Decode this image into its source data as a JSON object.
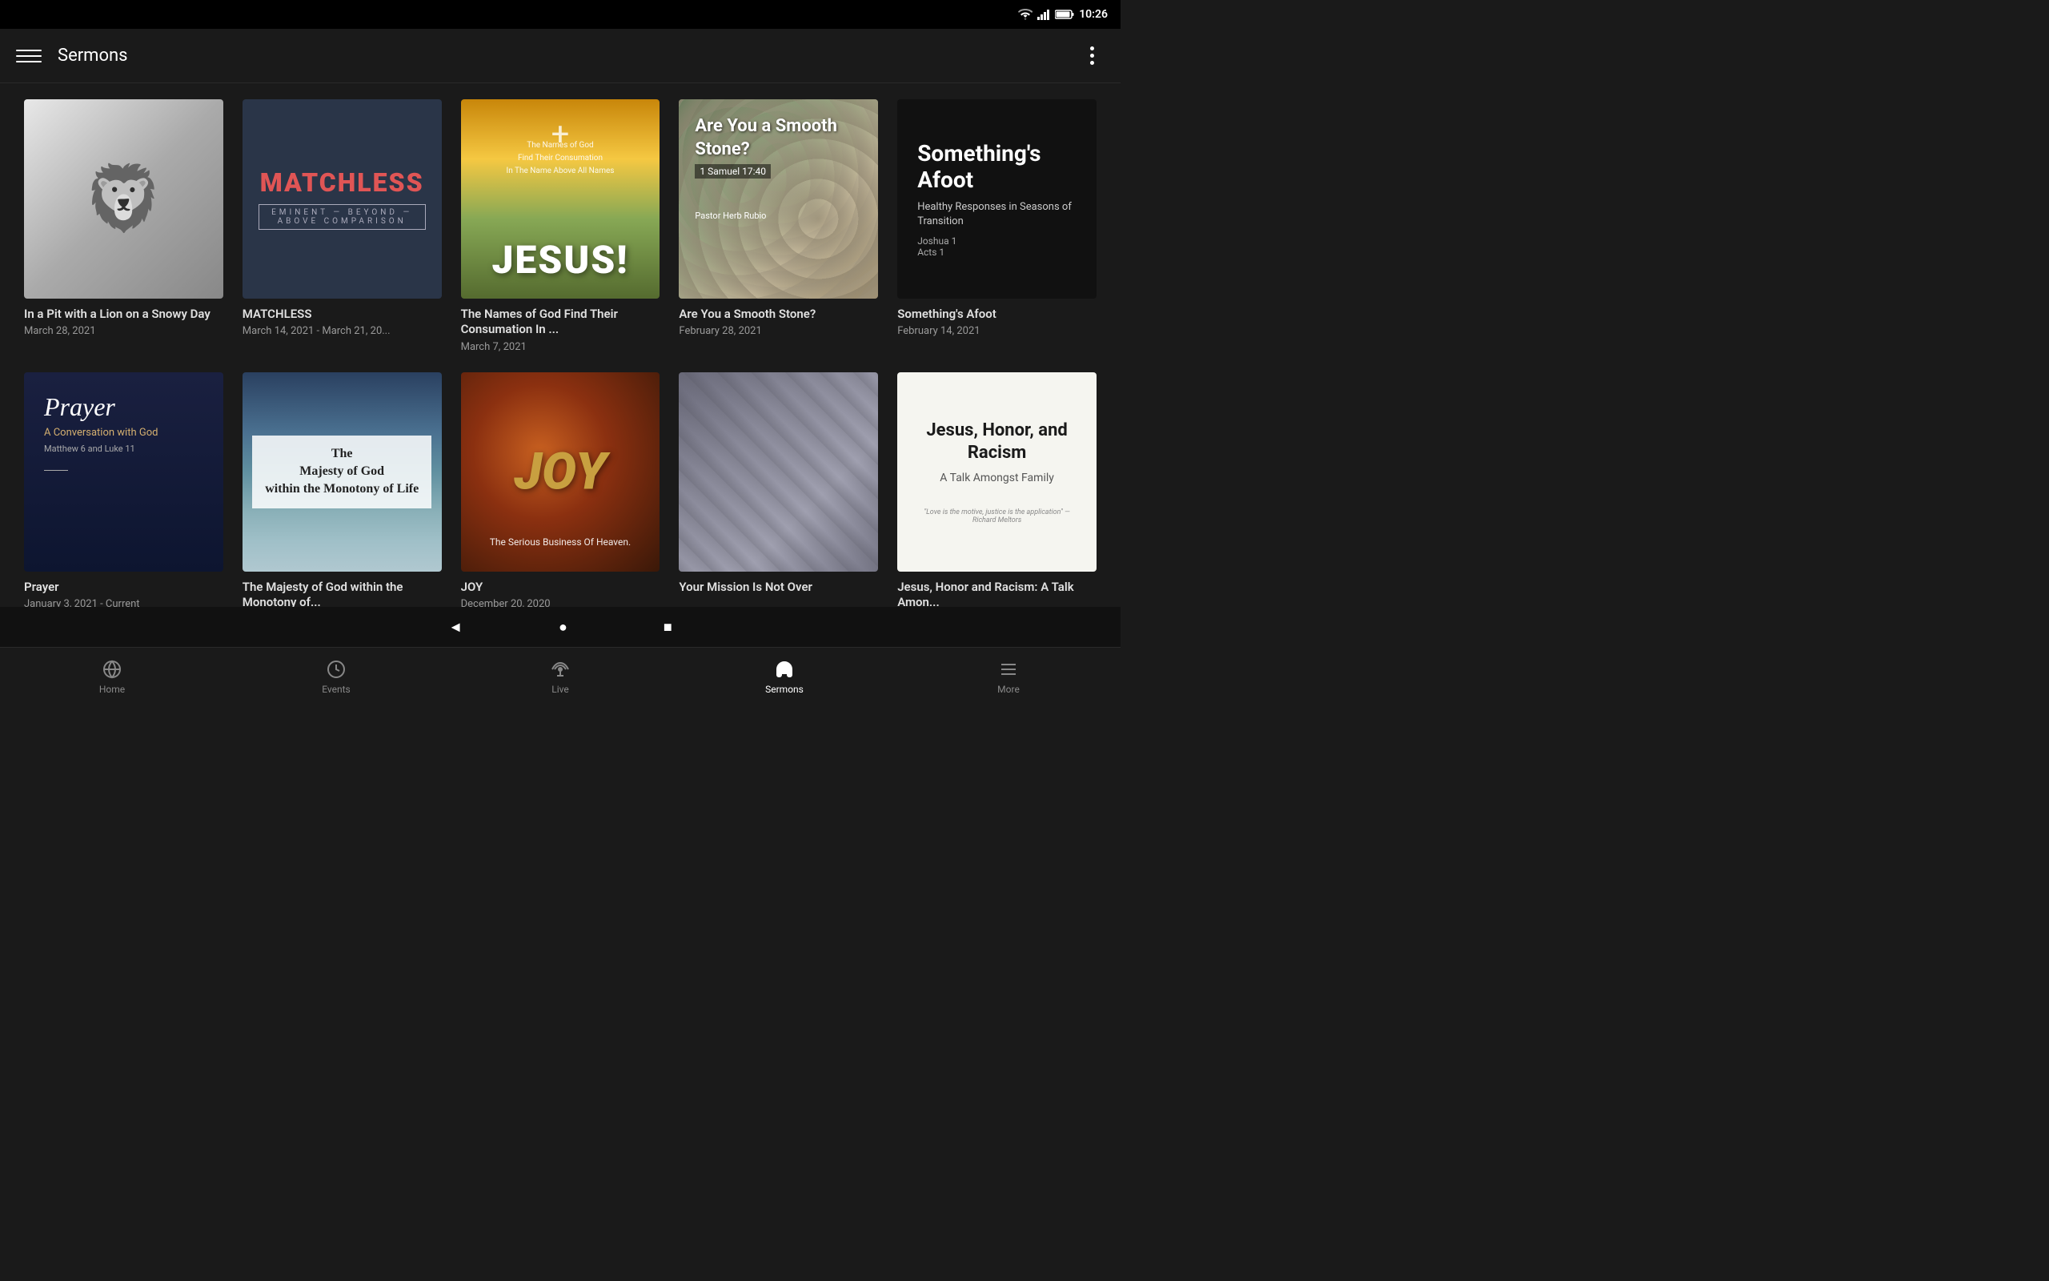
{
  "statusBar": {
    "time": "10:26",
    "icons": [
      "wifi",
      "signal",
      "battery"
    ]
  },
  "appBar": {
    "title": "Sermons",
    "menuIcon": "menu",
    "moreIcon": "more-vertical"
  },
  "sermons": [
    {
      "id": 1,
      "title": "In a Pit with a Lion on a Snowy Day",
      "date": "March 28, 2021",
      "thumbType": "lion"
    },
    {
      "id": 2,
      "title": "MATCHLESS",
      "date": "March 14, 2021 - March 21, 20...",
      "thumbType": "matchless",
      "thumbText": "MATCHLESS",
      "thumbSub": "EMINENT — BEYOND — ABOVE COMPARISON"
    },
    {
      "id": 3,
      "title": "The Names of God Find Their Consumation In ...",
      "date": "March 7, 2021",
      "thumbType": "jesus",
      "thumbTopText": "The Names of God\nFind Their Consumation\nIn The Name Above All Names",
      "thumbMain": "JESUS!"
    },
    {
      "id": 4,
      "title": "Are You a Smooth Stone?",
      "date": "February 28, 2021",
      "thumbType": "stones",
      "thumbTitle": "Are You a Smooth Stone?",
      "thumbVerse": "1 Samuel 17:40",
      "thumbPastor": "Pastor Herb Rubio"
    },
    {
      "id": 5,
      "title": "Something's Afoot",
      "date": "February 14, 2021",
      "thumbType": "afoot",
      "thumbTitle": "Something's Afoot",
      "thumbSub": "Healthy Responses in Seasons of Transition",
      "thumbBooks": "Joshua 1\nActs 1"
    },
    {
      "id": 6,
      "title": "Prayer",
      "date": "January 3, 2021 - Current",
      "thumbType": "prayer",
      "thumbScript": "Prayer",
      "thumbSub": "A Conversation with God",
      "thumbVerse": "Matthew 6 and Luke 11"
    },
    {
      "id": 7,
      "title": "The Majesty of God within the Monotony of...",
      "date": "",
      "thumbType": "majesty",
      "thumbText": "The Majesty of God within the Monotony of Life"
    },
    {
      "id": 8,
      "title": "JOY",
      "date": "December 20, 2020",
      "thumbType": "joy",
      "thumbMain": "JOY",
      "thumbSub": "The Serious Business Of Heaven."
    },
    {
      "id": 9,
      "title": "Your Mission Is Not Over",
      "date": "",
      "thumbType": "mission"
    },
    {
      "id": 10,
      "title": "Jesus, Honor and Racism: A Talk Amon...",
      "date": "",
      "thumbType": "jesus-honor",
      "thumbTitle": "Jesus, Honor, and Racism",
      "thumbSub": "A Talk Amongst Family",
      "thumbQuote": "\"Love is the motive, justice is the application\" — Richard Meltors"
    }
  ],
  "bottomNav": {
    "items": [
      {
        "id": "home",
        "label": "Home",
        "icon": "globe",
        "active": false
      },
      {
        "id": "events",
        "label": "Events",
        "icon": "clock",
        "active": false
      },
      {
        "id": "live",
        "label": "Live",
        "icon": "broadcast",
        "active": false
      },
      {
        "id": "sermons",
        "label": "Sermons",
        "icon": "headphones",
        "active": true
      },
      {
        "id": "more",
        "label": "More",
        "icon": "list",
        "active": false
      }
    ]
  },
  "systemNav": {
    "back": "◄",
    "home": "●",
    "recent": "■"
  }
}
